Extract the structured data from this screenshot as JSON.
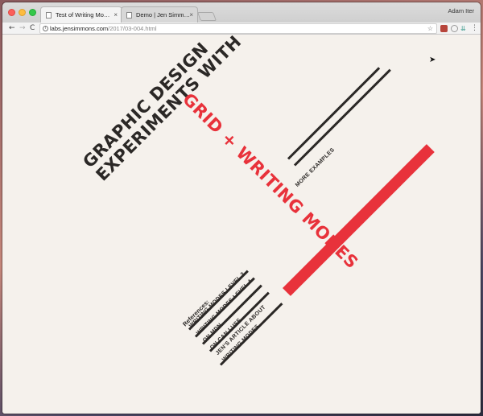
{
  "browser": {
    "tabs": [
      {
        "label": "Test of Writing Modes + CSS G",
        "close": "×"
      },
      {
        "label": "Demo | Jen Simmons Labs",
        "close": "×"
      }
    ],
    "profile": "Adam Iter",
    "address": {
      "host": "labs.jensimmons.com",
      "path": "/2017/03-004.html"
    },
    "nav": {
      "back": "←",
      "forward": "→",
      "reload": "C"
    }
  },
  "page": {
    "title_dark_lines": [
      "GRAPHIC DESIGN",
      "EXPERIMENTS WITH"
    ],
    "title_red": "GRID + WRITING MODES",
    "more_examples": "MORE EXAMPLES",
    "references_title": "References:",
    "references": [
      "WRITING MODES LEVEL 3",
      "WRITING MODES LEVEL 4",
      "ON MDN",
      "ON CAN I USE",
      "JEN'S ARTICLE ABOUT",
      "WRITING MODES"
    ]
  },
  "colors": {
    "accent_red": "#e8323b",
    "ink": "#2b2826",
    "page_bg": "#f5f1ec"
  }
}
